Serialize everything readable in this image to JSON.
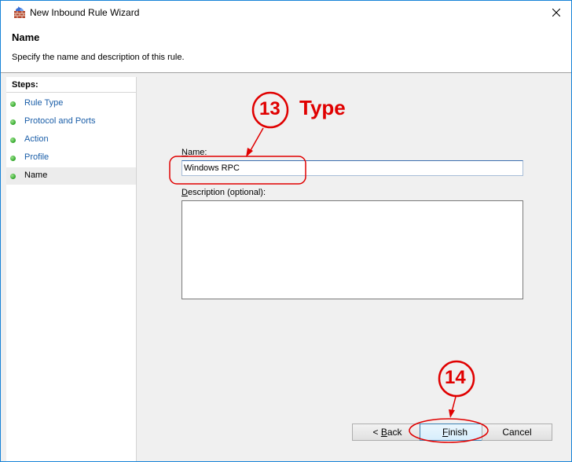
{
  "window": {
    "title": "New Inbound Rule Wizard"
  },
  "header": {
    "title": "Name",
    "description": "Specify the name and description of this rule."
  },
  "steps": {
    "title": "Steps:",
    "items": [
      {
        "label": "Rule Type"
      },
      {
        "label": "Protocol and Ports"
      },
      {
        "label": "Action"
      },
      {
        "label": "Profile"
      },
      {
        "label": "Name"
      }
    ]
  },
  "form": {
    "name_label_mnemonic": "N",
    "name_label_rest": "ame:",
    "name_value": "Windows RPC",
    "desc_label_mnemonic": "D",
    "desc_label_rest": "escription (optional):",
    "desc_value": ""
  },
  "buttons": {
    "back_prefix": "< ",
    "back_mnemonic": "B",
    "back_rest": "ack",
    "finish_mnemonic": "F",
    "finish_rest": "inish",
    "cancel": "Cancel"
  },
  "annotations": {
    "step13_number": "13",
    "step13_text": "Type",
    "step14_number": "14",
    "color": "#e00000"
  }
}
